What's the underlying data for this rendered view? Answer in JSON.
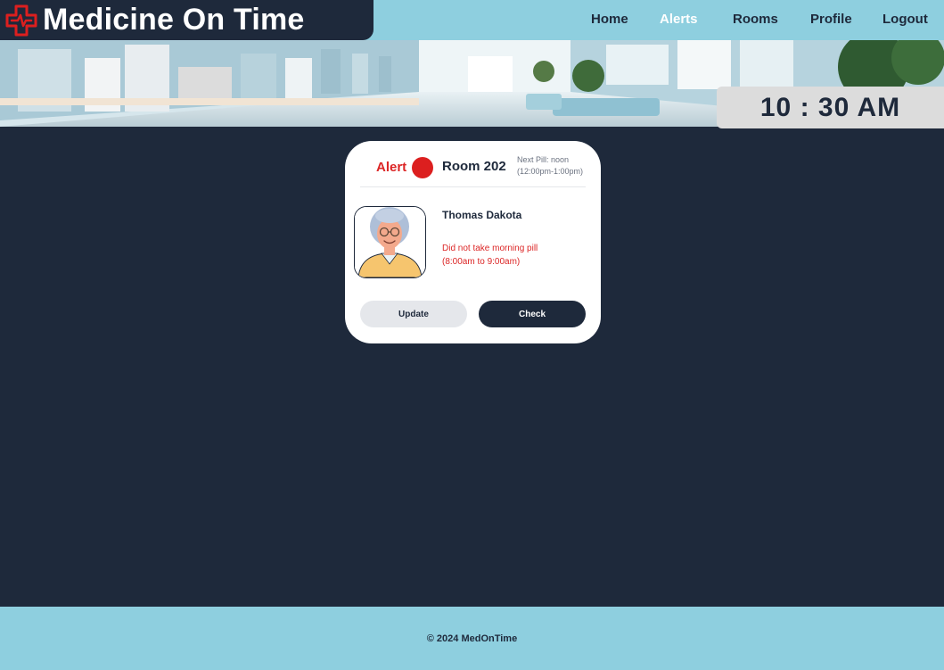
{
  "brand": {
    "name": "Medicine On Time",
    "icon": "medical-cross-icon",
    "accent": "#dc1f1f"
  },
  "nav": {
    "items": [
      {
        "label": "Home"
      },
      {
        "label": "Alerts",
        "active": true
      },
      {
        "label": "Rooms"
      },
      {
        "label": "Profile"
      },
      {
        "label": "Logout"
      }
    ]
  },
  "clock": {
    "time": "10 : 30 AM"
  },
  "card": {
    "status_label": "Alert",
    "status_color": "#dc1f1f",
    "room": "Room 202",
    "next_pill_line1": "Next Pill: noon",
    "next_pill_line2": "(12:00pm-1:00pm)",
    "patient_name": "Thomas Dakota",
    "alert_line1": "Did not take morning pill",
    "alert_line2": "(8:00am to 9:00am)",
    "update_label": "Update",
    "check_label": "Check"
  },
  "footer": {
    "text": "© 2024 MedOnTime"
  },
  "colors": {
    "navy": "#1e293b",
    "sky": "#8ecfdf",
    "alert_red": "#dc2626"
  }
}
